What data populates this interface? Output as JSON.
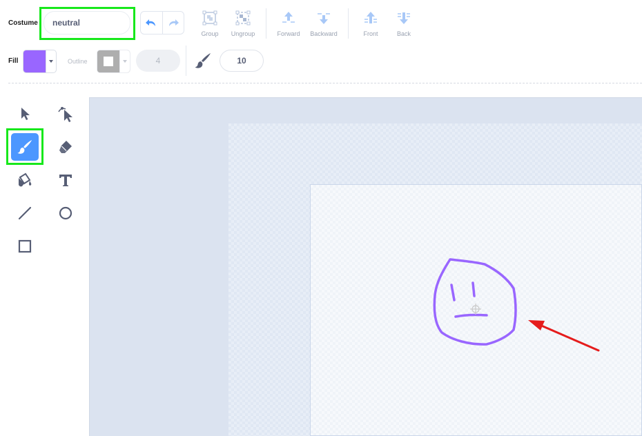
{
  "costume": {
    "label": "Costume",
    "value": "neutral"
  },
  "toolbar": {
    "undo_icon": "undo-icon",
    "redo_icon": "redo-icon",
    "group": "Group",
    "ungroup": "Ungroup",
    "forward": "Forward",
    "backward": "Backward",
    "front": "Front",
    "back": "Back"
  },
  "fill": {
    "label": "Fill",
    "color": "#9966ff"
  },
  "outline": {
    "label": "Outline",
    "color": "#ffffff",
    "width": "4"
  },
  "brush": {
    "icon": "brush-icon",
    "size": "10"
  },
  "tools": [
    {
      "name": "select",
      "icon": "arrow-icon"
    },
    {
      "name": "reshape",
      "icon": "reshape-icon"
    },
    {
      "name": "brush",
      "icon": "brush-icon",
      "selected": true
    },
    {
      "name": "eraser",
      "icon": "eraser-icon"
    },
    {
      "name": "fill",
      "icon": "fill-bucket-icon"
    },
    {
      "name": "text",
      "icon": "text-icon"
    },
    {
      "name": "line",
      "icon": "line-icon"
    },
    {
      "name": "circle",
      "icon": "circle-icon"
    },
    {
      "name": "rectangle",
      "icon": "rectangle-icon"
    }
  ],
  "colors": {
    "accent": "#4c97ff",
    "highlight": "#17e81b",
    "stroke": "#9966ff",
    "annotation_arrow": "#e51c1c"
  }
}
